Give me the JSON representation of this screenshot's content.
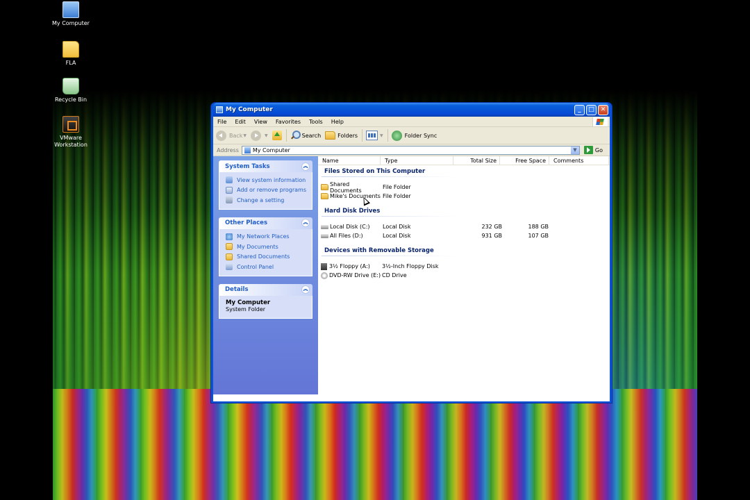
{
  "desktop": {
    "icons": [
      {
        "label": "My Computer",
        "icon": "my-computer-icon"
      },
      {
        "label": "FLA",
        "icon": "folder-icon"
      },
      {
        "label": "Recycle Bin",
        "icon": "recycle-bin-icon"
      },
      {
        "label": "VMware\nWorkstation",
        "icon": "vmware-icon"
      }
    ]
  },
  "window": {
    "title": "My Computer",
    "controls": {
      "minimize": "_",
      "maximize": "□",
      "close": "✕"
    },
    "menu": [
      "File",
      "Edit",
      "View",
      "Favorites",
      "Tools",
      "Help"
    ],
    "toolbar": {
      "back": "Back",
      "search": "Search",
      "folders": "Folders",
      "folder_sync": "Folder Sync"
    },
    "address": {
      "label": "Address",
      "value": "My Computer",
      "go": "Go"
    }
  },
  "taskpane": {
    "system_tasks": {
      "title": "System Tasks",
      "items": [
        "View system information",
        "Add or remove programs",
        "Change a setting"
      ]
    },
    "other_places": {
      "title": "Other Places",
      "items": [
        "My Network Places",
        "My Documents",
        "Shared Documents",
        "Control Panel"
      ]
    },
    "details": {
      "title": "Details",
      "name": "My Computer",
      "kind": "System Folder"
    }
  },
  "filelist": {
    "columns": {
      "name": "Name",
      "type": "Type",
      "total": "Total Size",
      "free": "Free Space",
      "comments": "Comments"
    },
    "groups": [
      {
        "title": "Files Stored on This Computer",
        "rows": [
          {
            "name": "Shared Documents",
            "type": "File Folder",
            "total": "",
            "free": ""
          },
          {
            "name": "Mike's Documents",
            "type": "File Folder",
            "total": "",
            "free": ""
          }
        ]
      },
      {
        "title": "Hard Disk Drives",
        "rows": [
          {
            "name": "Local Disk (C:)",
            "type": "Local Disk",
            "total": "232 GB",
            "free": "188 GB"
          },
          {
            "name": "All Files (D:)",
            "type": "Local Disk",
            "total": "931 GB",
            "free": "107 GB"
          }
        ]
      },
      {
        "title": "Devices with Removable Storage",
        "rows": [
          {
            "name": "3½ Floppy (A:)",
            "type": "3½-Inch Floppy Disk",
            "total": "",
            "free": ""
          },
          {
            "name": "DVD-RW Drive (E:)",
            "type": "CD Drive",
            "total": "",
            "free": ""
          }
        ]
      }
    ]
  }
}
